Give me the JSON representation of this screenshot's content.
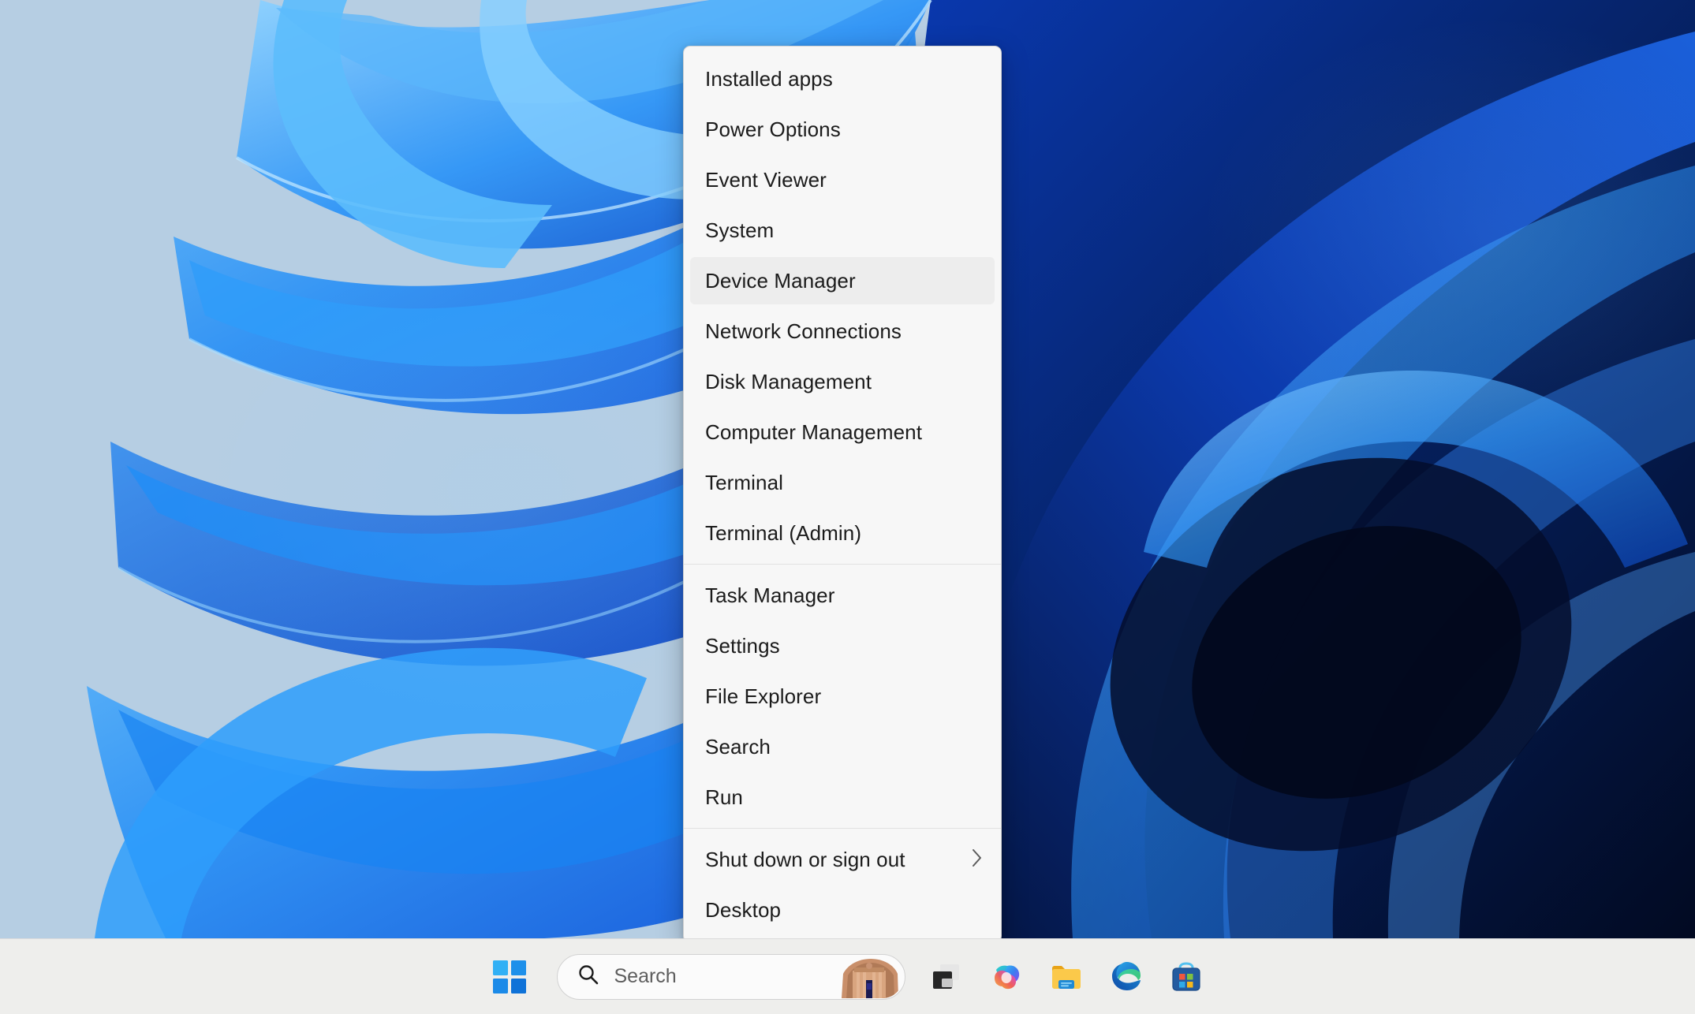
{
  "desktop": {
    "wallpaper_name": "windows-11-bloom-wallpaper",
    "colors": {
      "wallpaper_light": "#b9d0e4",
      "wallpaper_mid_blue": "#1f7ef0",
      "wallpaper_deep_blue": "#0b3fc0",
      "wallpaper_dark": "#041037"
    }
  },
  "context_menu": {
    "name": "win-x-power-user-menu",
    "selected_item": "Device Manager",
    "groups": [
      {
        "items": [
          {
            "label": "Installed apps",
            "submenu": false
          },
          {
            "label": "Power Options",
            "submenu": false
          },
          {
            "label": "Event Viewer",
            "submenu": false
          },
          {
            "label": "System",
            "submenu": false
          },
          {
            "label": "Device Manager",
            "submenu": false
          },
          {
            "label": "Network Connections",
            "submenu": false
          },
          {
            "label": "Disk Management",
            "submenu": false
          },
          {
            "label": "Computer Management",
            "submenu": false
          },
          {
            "label": "Terminal",
            "submenu": false
          },
          {
            "label": "Terminal (Admin)",
            "submenu": false
          }
        ]
      },
      {
        "items": [
          {
            "label": "Task Manager",
            "submenu": false
          },
          {
            "label": "Settings",
            "submenu": false
          },
          {
            "label": "File Explorer",
            "submenu": false
          },
          {
            "label": "Search",
            "submenu": false
          },
          {
            "label": "Run",
            "submenu": false
          }
        ]
      },
      {
        "items": [
          {
            "label": "Shut down or sign out",
            "submenu": true
          },
          {
            "label": "Desktop",
            "submenu": false
          }
        ]
      }
    ],
    "submenu_icon": "chevron-right-icon",
    "highlight_color": "#ededed",
    "background_color": "#f7f7f7"
  },
  "taskbar": {
    "background_color": "#eeeeec",
    "start_button": {
      "icon": "windows-logo-icon",
      "label": "Start"
    },
    "search": {
      "icon": "search-icon",
      "placeholder": "Search",
      "value": "",
      "thumbnail": "petra-treasury-thumbnail"
    },
    "buttons": [
      {
        "name": "task-view-button",
        "icon": "task-view-icon",
        "label": "Task View"
      },
      {
        "name": "copilot-button",
        "icon": "copilot-icon",
        "label": "Copilot"
      },
      {
        "name": "file-explorer-button",
        "icon": "file-explorer-icon",
        "label": "File Explorer"
      },
      {
        "name": "edge-button",
        "icon": "microsoft-edge-icon",
        "label": "Microsoft Edge"
      },
      {
        "name": "store-button",
        "icon": "microsoft-store-icon",
        "label": "Microsoft Store"
      }
    ]
  }
}
